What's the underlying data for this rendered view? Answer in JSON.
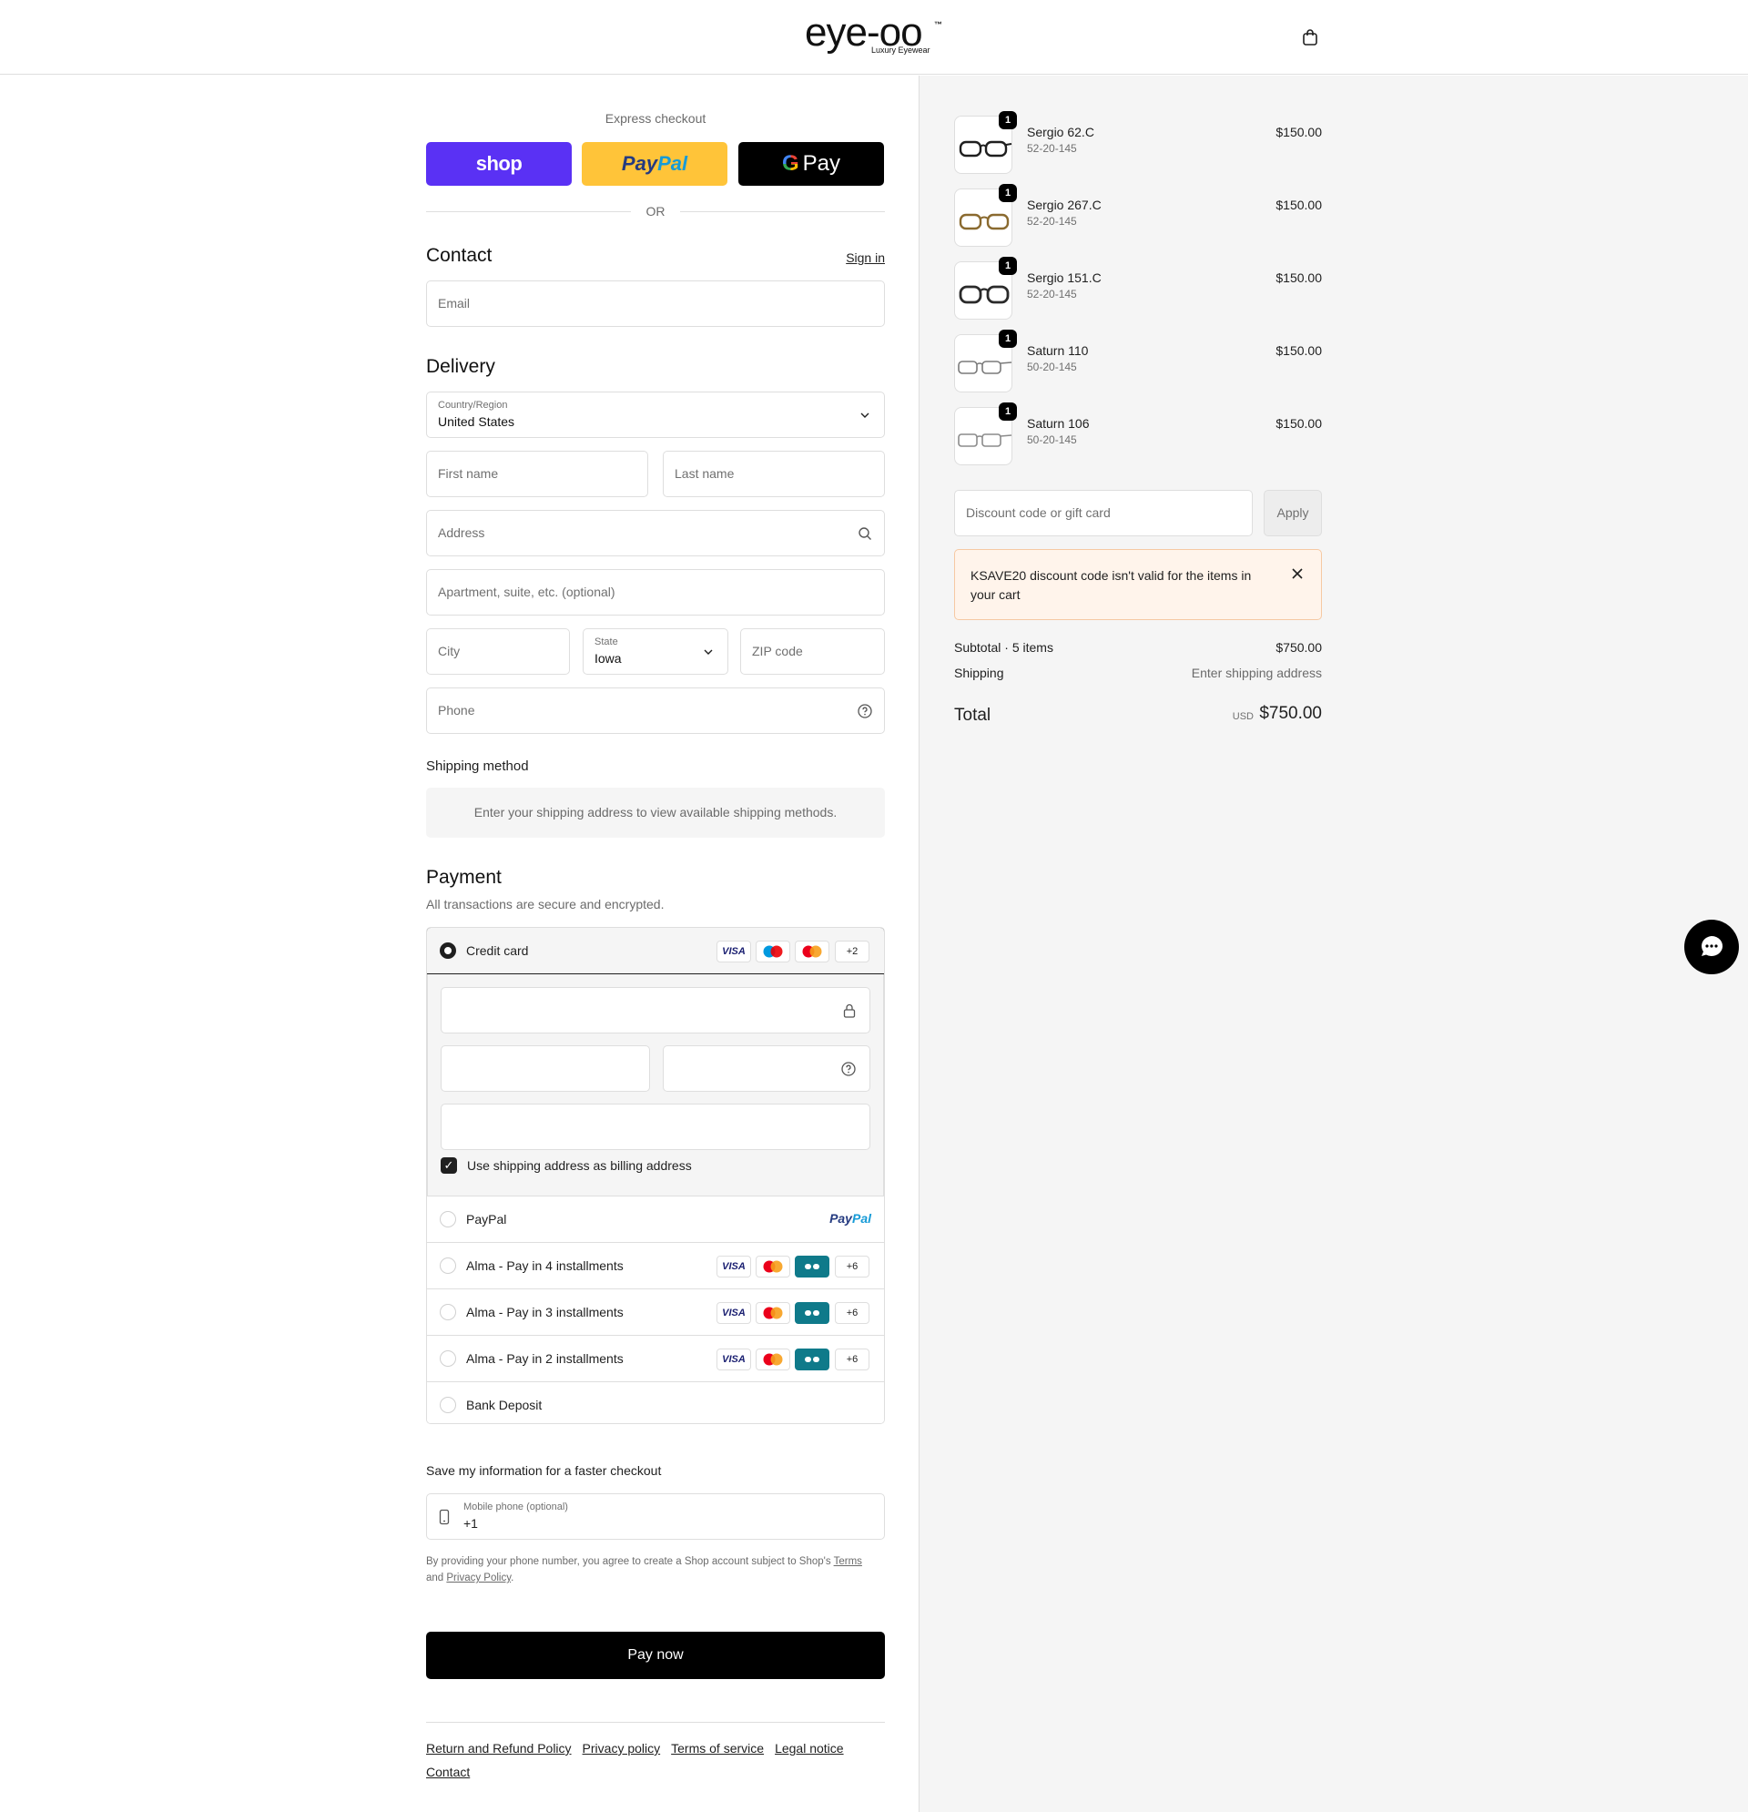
{
  "header": {
    "brand": "eye-oo",
    "brand_tm": "™",
    "brand_sub": "Luxury Eyewear"
  },
  "express": {
    "label": "Express checkout",
    "shop": "shop",
    "paypal_a": "Pay",
    "paypal_b": "Pal",
    "gpay_g": "G",
    "gpay_text": "Pay",
    "or": "OR"
  },
  "contact": {
    "title": "Contact",
    "signin": "Sign in",
    "email_placeholder": "Email"
  },
  "delivery": {
    "title": "Delivery",
    "country_label": "Country/Region",
    "country_value": "United States",
    "first_name": "First name",
    "last_name": "Last name",
    "address": "Address",
    "apartment": "Apartment, suite, etc. (optional)",
    "city": "City",
    "state_label": "State",
    "state_value": "Iowa",
    "zip": "ZIP code",
    "phone": "Phone"
  },
  "shipping": {
    "title": "Shipping method",
    "info": "Enter your shipping address to view available shipping methods."
  },
  "payment": {
    "title": "Payment",
    "subtitle": "All transactions are secure and encrypted.",
    "credit_card": "Credit card",
    "visa": "VISA",
    "cc_more": "+2",
    "billing_checkbox": "Use shipping address as billing address",
    "paypal": "PayPal",
    "paypal_logo_a": "Pay",
    "paypal_logo_b": "Pal",
    "alma4": "Alma - Pay in 4 installments",
    "alma3": "Alma - Pay in 3 installments",
    "alma2": "Alma - Pay in 2 installments",
    "alma_more": "+6",
    "bank": "Bank Deposit"
  },
  "save_info": {
    "title": "Save my information for a faster checkout",
    "mobile_label": "Mobile phone (optional)",
    "mobile_value": "+1",
    "legal_a": "By providing your phone number, you agree to create a Shop account subject to Shop's",
    "terms": "Terms",
    "legal_and": "and",
    "privacy": "Privacy Policy",
    "legal_end": "."
  },
  "pay_now": "Pay now",
  "footer": {
    "links": [
      "Return and Refund Policy",
      "Privacy policy",
      "Terms of service",
      "Legal notice",
      "Contact"
    ]
  },
  "cart": {
    "items": [
      {
        "name": "Sergio 62.C",
        "size": "52-20-145",
        "price": "$150.00",
        "qty": "1"
      },
      {
        "name": "Sergio 267.C",
        "size": "52-20-145",
        "price": "$150.00",
        "qty": "1"
      },
      {
        "name": "Sergio 151.C",
        "size": "52-20-145",
        "price": "$150.00",
        "qty": "1"
      },
      {
        "name": "Saturn 110",
        "size": "50-20-145",
        "price": "$150.00",
        "qty": "1"
      },
      {
        "name": "Saturn 106",
        "size": "50-20-145",
        "price": "$150.00",
        "qty": "1"
      }
    ],
    "discount_placeholder": "Discount code or gift card",
    "apply": "Apply",
    "notice": "KSAVE20 discount code isn't valid for the items in your cart",
    "subtotal_label": "Subtotal · 5 items",
    "subtotal_value": "$750.00",
    "shipping_label": "Shipping",
    "shipping_value": "Enter shipping address",
    "total_label": "Total",
    "currency": "USD",
    "total_value": "$750.00"
  },
  "colors": {
    "shop": "#5a31f4",
    "paypal": "#ffc439",
    "notice_bg": "#fff4eb",
    "notice_border": "#f6c9a3"
  },
  "frame_colors": [
    "#1f1f1f",
    "#8a6a2f",
    "#2a2a2a",
    "#7a7a7a",
    "#8b8b8b"
  ]
}
